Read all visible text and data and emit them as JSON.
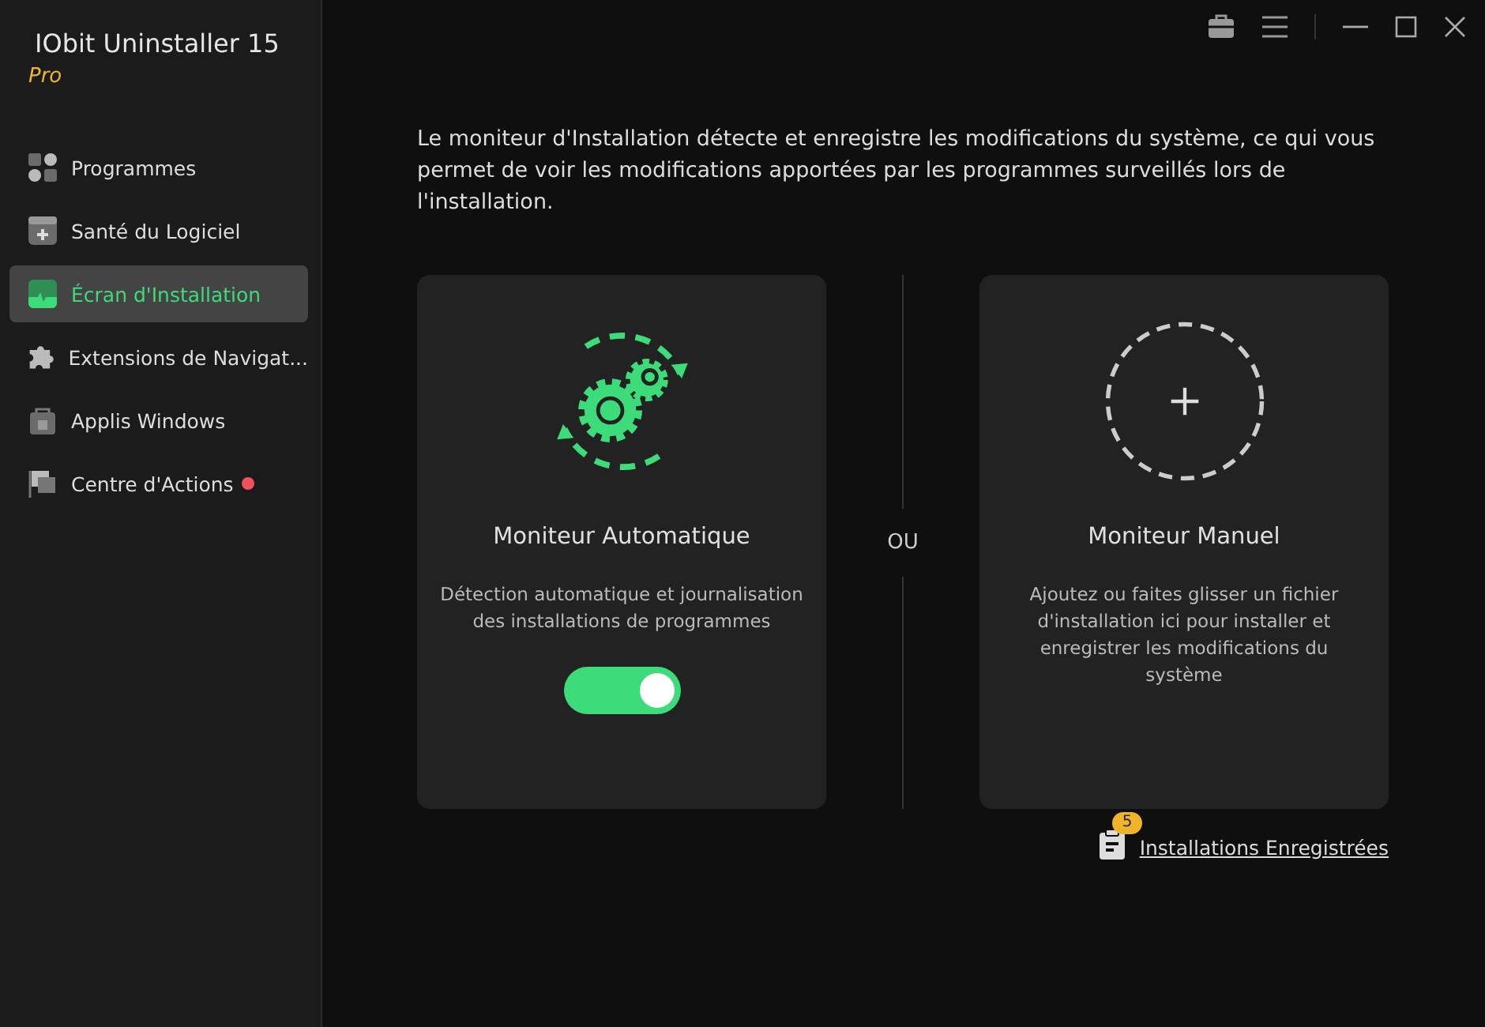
{
  "app": {
    "title": "IObit Uninstaller 15",
    "edition": "Pro"
  },
  "sidebar": {
    "items": [
      {
        "label": "Programmes",
        "kind": "grid",
        "selected": false,
        "alert": false
      },
      {
        "label": "Santé du Logiciel",
        "kind": "health",
        "selected": false,
        "alert": false
      },
      {
        "label": "Écran d'Installation",
        "kind": "monitor",
        "selected": true,
        "alert": false
      },
      {
        "label": "Extensions de Navigat...",
        "kind": "puzzle",
        "selected": false,
        "alert": false
      },
      {
        "label": "Applis Windows",
        "kind": "bag",
        "selected": false,
        "alert": false
      },
      {
        "label": "Centre d'Actions",
        "kind": "flag",
        "selected": false,
        "alert": true
      }
    ]
  },
  "intro": "Le moniteur d'Installation détecte et enregistre les modifications du système, ce qui vous permet de voir les modifications apportées par les programmes surveillés lors de l'installation.",
  "cards": [
    {
      "kind": "auto",
      "title": "Moniteur Automatique",
      "description": "Détection automatique et journalisation des installations de programmes",
      "toggle_on": true
    },
    {
      "kind": "manual",
      "title": "Moniteur Manuel",
      "description": "Ajoutez ou faites glisser un fichier d'installation ici pour installer et enregistrer les modifications du système"
    }
  ],
  "separator": "OU",
  "records_link": {
    "label": "Installations Enregistrées",
    "badge": "5"
  }
}
